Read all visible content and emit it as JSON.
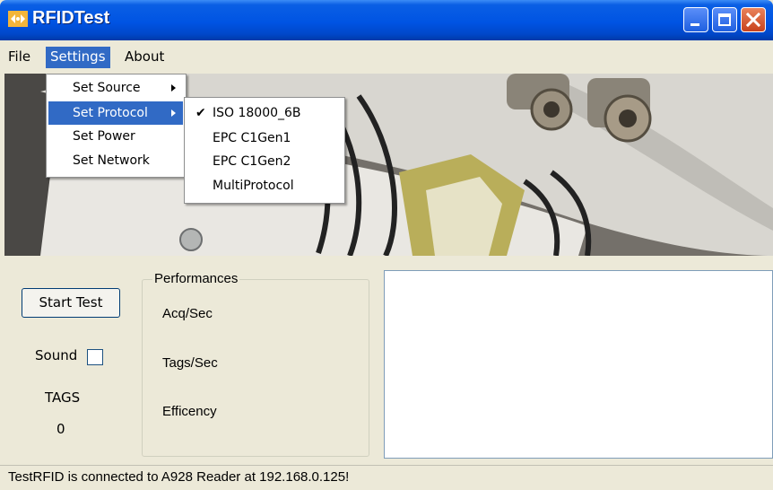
{
  "window": {
    "title": "RFIDTest"
  },
  "menubar": {
    "file": "File",
    "settings": "Settings",
    "about": "About"
  },
  "settings_menu": {
    "items": [
      {
        "label": "Set Source",
        "has_submenu": true
      },
      {
        "label": "Set Protocol",
        "has_submenu": true,
        "highlighted": true
      },
      {
        "label": "Set Power",
        "has_submenu": false
      },
      {
        "label": "Set Network",
        "has_submenu": false
      }
    ]
  },
  "protocol_menu": {
    "items": [
      {
        "label": "ISO 18000_6B",
        "checked": true
      },
      {
        "label": "EPC C1Gen1",
        "checked": false
      },
      {
        "label": "EPC C1Gen2",
        "checked": false
      },
      {
        "label": "MultiProtocol",
        "checked": false
      }
    ],
    "check_mark": "✔"
  },
  "controls": {
    "start_button": "Start Test",
    "sound_label": "Sound",
    "sound_checked": false,
    "tags_label": "TAGS",
    "tags_value": "0"
  },
  "performances": {
    "title": "Performances",
    "labels": [
      "Acq/Sec",
      "Tags/Sec",
      "Efficency"
    ]
  },
  "output_box": {
    "value": ""
  },
  "status_bar": {
    "text": "TestRFID is connected to A928 Reader at 192.168.0.125!"
  },
  "colors": {
    "titlebar": "#0054e3",
    "menu_highlight": "#316ac5",
    "window_bg": "#ece9d8",
    "close_button": "#c8421d"
  }
}
